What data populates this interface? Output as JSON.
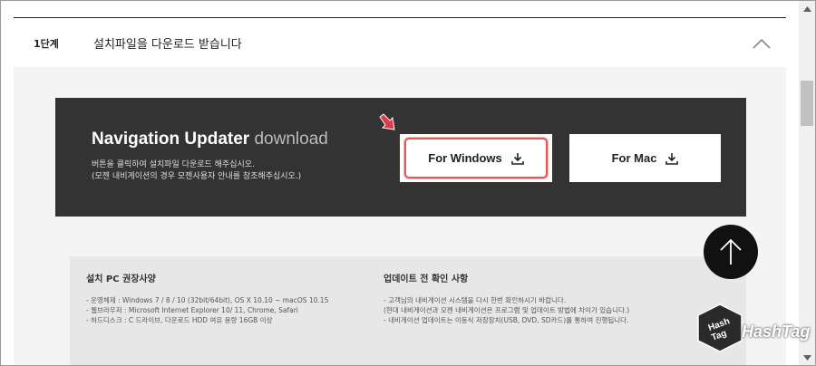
{
  "step": {
    "label": "1단계",
    "title": "설치파일을 다운로드 받습니다"
  },
  "download": {
    "title_strong": "Navigation Updater",
    "title_light": "download",
    "desc_line1": "버튼을 클릭하여 설치파일 다운로드 해주십시오.",
    "desc_line2": "(모젠 내비게이션의 경우 모젠사용자 안내를 참조해주십시오.)",
    "windows_label": "For Windows",
    "mac_label": "For Mac"
  },
  "specs": {
    "left_title": "설치 PC 권장사양",
    "left_lines": [
      "- 운영체제 : Windows 7 / 8 / 10 (32bit/64bit), OS X 10.10 ~ macOS 10.15",
      "- 웹브라우저 : Microsoft Internet Explorer 10/ 11, Chrome, Safari",
      "- 하드디스크 : C 드라이브, 다운로드 HDD 여유 용량 16GB 이상"
    ],
    "right_title": "업데이트 전 확인 사항",
    "right_lines": [
      "- 고객님의 내비게이션 시스템을 다시 한번 확인하시기 바랍니다.",
      "(현대 내비게이션과 모젠 내비게이션은 프로그램 및 업데이트 방법에 차이가 있습니다.)",
      "- 내비게이션 업데이트는 이동식 저장장치(USB, DVD, SD카드)를 통하여 진행됩니다."
    ]
  },
  "watermark": {
    "badge_lines": [
      "Hash",
      "Tag"
    ],
    "text": "HashTag"
  },
  "icons": {
    "collapse": "chevron-up-icon",
    "download": "download-icon",
    "top": "arrow-up-icon"
  },
  "colors": {
    "dark_panel": "#333333",
    "highlight_border": "#e05a5a",
    "pointer": "#e03a4a"
  }
}
